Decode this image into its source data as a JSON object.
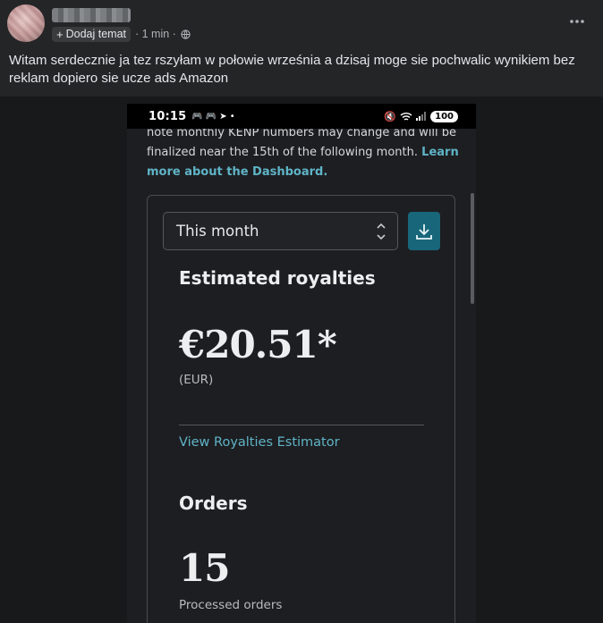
{
  "post": {
    "topic_label": "Dodaj temat",
    "time": "· 1 min ·",
    "text": "Witam serdecznie ja tez rszyłam w połowie września a dzisaj moge sie pochwalic wynikiem bez reklam dopiero sie ucze ads Amazon"
  },
  "phone": {
    "status_time": "10:15",
    "battery": "100"
  },
  "dashboard": {
    "notice_text": "note monthly KENP numbers may change and will be finalized near the 15th of the following month.",
    "notice_link": "Learn more about the Dashboard.",
    "period_value": "This month",
    "royalties_heading": "Estimated royalties",
    "royalties_value": "€20.51*",
    "currency": "(EUR)",
    "estimator_link": "View Royalties Estimator",
    "orders_heading": "Orders",
    "orders_value": "15",
    "orders_label": "Processed orders"
  }
}
